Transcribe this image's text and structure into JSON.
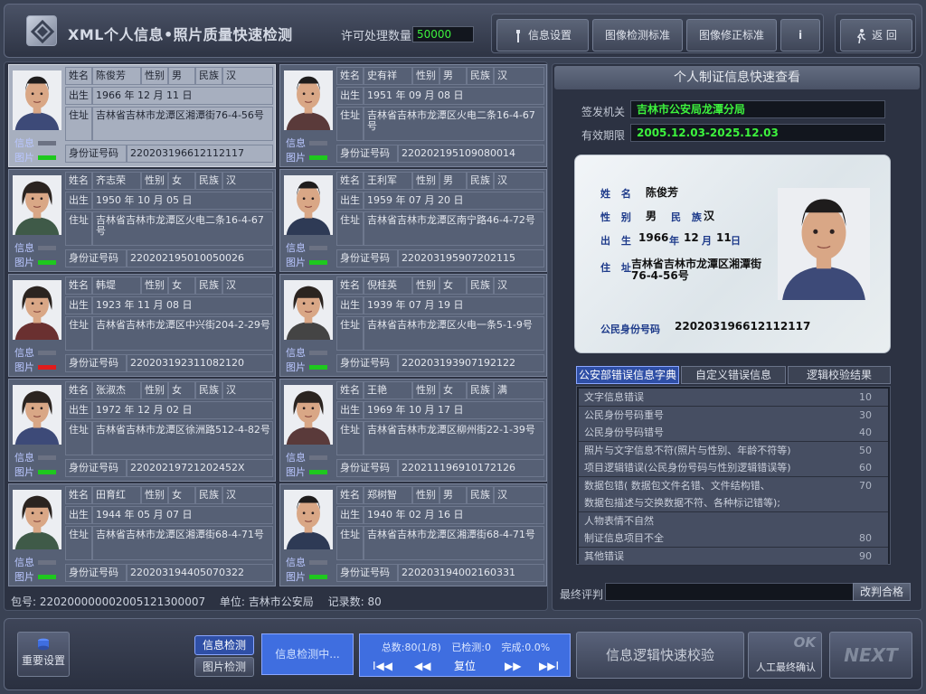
{
  "header": {
    "title": "XML个人信息•照片质量快速检测",
    "license_label": "许可处理数量",
    "license_count": "50000",
    "buttons": {
      "info_settings": "信息设置",
      "image_standard": "图像检测标准",
      "correction_standard": "图像修正标准",
      "info": "i",
      "back": "返  回"
    }
  },
  "labels": {
    "name": "姓名",
    "gender": "性别",
    "ethnicity": "民族",
    "birth": "出生",
    "address": "住址",
    "id": "身份证号码",
    "flag_info": "信息",
    "flag_photo": "图片"
  },
  "records": [
    {
      "name": "陈俊芳",
      "gender": "男",
      "ethnicity": "汉",
      "birth": "1966 年 12 月 11 日",
      "address": "吉林省吉林市龙潭区湘潭街76-4-56号",
      "id": "220203196612112117",
      "info_flag": "neutral",
      "photo_flag": "ok",
      "selected": true
    },
    {
      "name": "史有祥",
      "gender": "男",
      "ethnicity": "汉",
      "birth": "1951 年 09 月 08 日",
      "address": "吉林省吉林市龙潭区火电二条16-4-67号",
      "id": "220202195109080014",
      "info_flag": "neutral",
      "photo_flag": "ok"
    },
    {
      "name": "齐志荣",
      "gender": "女",
      "ethnicity": "汉",
      "birth": "1950 年 10 月 05 日",
      "address": "吉林省吉林市龙潭区火电二条16-4-67号",
      "id": "220202195010050026",
      "info_flag": "neutral",
      "photo_flag": "ok"
    },
    {
      "name": "王利军",
      "gender": "男",
      "ethnicity": "汉",
      "birth": "1959 年 07 月 20 日",
      "address": "吉林省吉林市龙潭区南宁路46-4-72号",
      "id": "220203195907202115",
      "info_flag": "neutral",
      "photo_flag": "ok"
    },
    {
      "name": "韩堤",
      "gender": "女",
      "ethnicity": "汉",
      "birth": "1923 年 11 月 08 日",
      "address": "吉林省吉林市龙潭区中兴街204-2-29号",
      "id": "220203192311082120",
      "info_flag": "neutral",
      "photo_flag": "bad"
    },
    {
      "name": "倪桂英",
      "gender": "女",
      "ethnicity": "汉",
      "birth": "1939 年 07 月 19 日",
      "address": "吉林省吉林市龙潭区火电一条5-1-9号",
      "id": "220203193907192122",
      "info_flag": "neutral",
      "photo_flag": "ok"
    },
    {
      "name": "张淑杰",
      "gender": "女",
      "ethnicity": "汉",
      "birth": "1972 年 12 月 02 日",
      "address": "吉林省吉林市龙潭区徐洲路512-4-82号",
      "id": "22020219721202452X",
      "info_flag": "neutral",
      "photo_flag": "ok"
    },
    {
      "name": "王艳",
      "gender": "女",
      "ethnicity": "满",
      "birth": "1969 年 10 月 17 日",
      "address": "吉林省吉林市龙潭区柳州街22-1-39号",
      "id": "220211196910172126",
      "info_flag": "neutral",
      "photo_flag": "ok"
    },
    {
      "name": "田育红",
      "gender": "女",
      "ethnicity": "汉",
      "birth": "1944 年 05 月 07 日",
      "address": "吉林省吉林市龙潭区湘潭街68-4-71号",
      "id": "220203194405070322",
      "info_flag": "neutral",
      "photo_flag": "ok"
    },
    {
      "name": "郑树智",
      "gender": "男",
      "ethnicity": "汉",
      "birth": "1940 年 02 月 16 日",
      "address": "吉林省吉林市龙潭区湘潭街68-4-71号",
      "id": "220203194002160331",
      "info_flag": "neutral",
      "photo_flag": "ok"
    }
  ],
  "status": {
    "package": "包号: 220200000002005121300007",
    "unit": "单位: 吉林市公安局",
    "count": "记录数: 80"
  },
  "quickview": {
    "title": "个人制证信息快速查看",
    "issuer_label": "签发机关",
    "issuer": "吉林市公安局龙潭分局",
    "validity_label": "有效期限",
    "validity": "2005.12.03-2025.12.03",
    "card": {
      "name_label": "姓 名",
      "gender_label": "性 别",
      "ethnicity_label": "民 族",
      "birth_label": "出 生",
      "address_label": "住 址",
      "id_label": "公民身份号码",
      "name": "陈俊芳",
      "gender": "男",
      "ethnicity": "汉",
      "birth_year": "1966",
      "birth_year_unit": "年",
      "birth_month": "12",
      "birth_month_unit": "月",
      "birth_day": "11",
      "birth_day_unit": "日",
      "address": "吉林省吉林市龙潭区湘潭街76-4-56号",
      "id": "220203196612112117"
    },
    "tabs": [
      "公安部错误信息字典",
      "自定义错误信息",
      "逻辑校验结果"
    ],
    "errors": [
      {
        "label": "文字信息错误",
        "code": "10"
      },
      {
        "label": "公民身份号码重号",
        "code": "30"
      },
      {
        "label": "公民身份号码错号",
        "code": "40"
      },
      {
        "label": "照片与文字信息不符(照片与性别、年龄不符等)",
        "code": "50"
      },
      {
        "label": "项目逻辑错误(公民身份号码与性别逻辑错误等)",
        "code": "60"
      },
      {
        "label": "数据包错( 数据包文件名错、文件结构错、",
        "code": "70"
      },
      {
        "label": "数据包描述与交换数据不符、各种标记错等);",
        "code": ""
      },
      {
        "label": "人物表情不自然",
        "code": ""
      },
      {
        "label": "制证信息项目不全",
        "code": "80"
      },
      {
        "label": "其他错误",
        "code": "90"
      }
    ],
    "eval_label": "最终评判",
    "eval_button": "改判合格"
  },
  "toolbar": {
    "settings": "重要设置",
    "mode_info": "信息检测",
    "mode_photo": "图片检测",
    "progress": "信息检测中...",
    "total": "总数:80(1/8)",
    "checked": "已检测:0",
    "complete": "完成:0.0%",
    "first": "I◀◀",
    "prev": "◀◀",
    "reset": "复位",
    "next_page": "▶▶",
    "last": "▶▶I",
    "logic_check": "信息逻辑快速校验",
    "manual_ok": "OK",
    "manual_confirm": "人工最终确认",
    "next": "NEXT"
  }
}
